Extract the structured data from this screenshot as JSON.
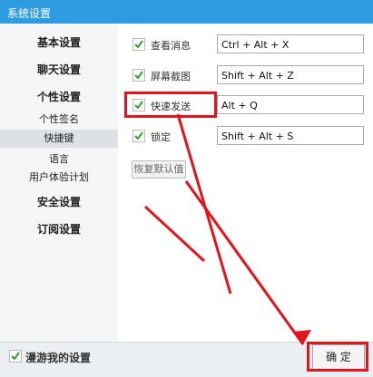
{
  "window": {
    "title": "系统设置"
  },
  "sidebar": {
    "items": [
      {
        "label": "基本设置"
      },
      {
        "label": "聊天设置"
      },
      {
        "label": "个性设置"
      },
      {
        "label": "个性签名"
      },
      {
        "label": "快捷键"
      },
      {
        "label": "语言"
      },
      {
        "label": "用户体验计划"
      },
      {
        "label": "安全设置"
      },
      {
        "label": "订阅设置"
      }
    ]
  },
  "shortcuts": [
    {
      "label": "查看消息",
      "key": "Ctrl + Alt + X",
      "checked": true
    },
    {
      "label": "屏幕截图",
      "key": "Shift + Alt + Z",
      "checked": true
    },
    {
      "label": "快速发送",
      "key": "Alt + Q",
      "checked": true
    },
    {
      "label": "锁定",
      "key": "Shift + Alt + S",
      "checked": true
    }
  ],
  "restore_button": {
    "label": "恢复默认值"
  },
  "footer": {
    "roaming_label": "漫游我的设置",
    "roaming_checked": true,
    "ok_label": "确 定"
  },
  "colors": {
    "titlebar": "#2e9ce0",
    "annotation": "#e3141b",
    "check": "#2aa52a"
  }
}
